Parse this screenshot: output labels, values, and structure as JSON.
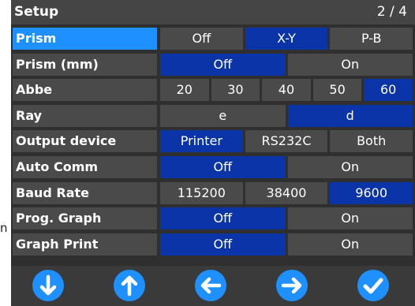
{
  "stub": {
    "text": "n"
  },
  "header": {
    "title": "Setup",
    "page": "2 / 4"
  },
  "rows": [
    {
      "label": "Prism",
      "active": true,
      "options": [
        {
          "text": "Off",
          "selected": false
        },
        {
          "text": "X-Y",
          "selected": true
        },
        {
          "text": "P-B",
          "selected": false
        }
      ]
    },
    {
      "label": "Prism (mm)",
      "active": false,
      "options": [
        {
          "text": "Off",
          "selected": true
        },
        {
          "text": "On",
          "selected": false
        }
      ]
    },
    {
      "label": "Abbe",
      "active": false,
      "options": [
        {
          "text": "20",
          "selected": false
        },
        {
          "text": "30",
          "selected": false
        },
        {
          "text": "40",
          "selected": false
        },
        {
          "text": "50",
          "selected": false
        },
        {
          "text": "60",
          "selected": true
        }
      ]
    },
    {
      "label": "Ray",
      "active": false,
      "options": [
        {
          "text": "e",
          "selected": false
        },
        {
          "text": "d",
          "selected": true
        }
      ]
    },
    {
      "label": "Output device",
      "active": false,
      "options": [
        {
          "text": "Printer",
          "selected": true
        },
        {
          "text": "RS232C",
          "selected": false
        },
        {
          "text": "Both",
          "selected": false
        }
      ]
    },
    {
      "label": "Auto Comm",
      "active": false,
      "options": [
        {
          "text": "Off",
          "selected": true
        },
        {
          "text": "On",
          "selected": false
        }
      ]
    },
    {
      "label": "Baud Rate",
      "active": false,
      "options": [
        {
          "text": "115200",
          "selected": false
        },
        {
          "text": "38400",
          "selected": false
        },
        {
          "text": "9600",
          "selected": true
        }
      ]
    },
    {
      "label": "Prog. Graph",
      "active": false,
      "options": [
        {
          "text": "Off",
          "selected": true
        },
        {
          "text": "On",
          "selected": false
        }
      ]
    },
    {
      "label": "Graph Print",
      "active": false,
      "options": [
        {
          "text": "Off",
          "selected": true
        },
        {
          "text": "On",
          "selected": false
        }
      ]
    }
  ],
  "footer": {
    "buttons": [
      {
        "name": "down-button",
        "icon": "arrow-down-icon"
      },
      {
        "name": "up-button",
        "icon": "arrow-up-icon"
      },
      {
        "name": "left-button",
        "icon": "arrow-left-icon"
      },
      {
        "name": "right-button",
        "icon": "arrow-right-icon"
      },
      {
        "name": "confirm-button",
        "icon": "check-icon"
      }
    ]
  },
  "colors": {
    "accent": "#1e90ff",
    "selected": "#0a34a8",
    "cell": "#4a4a4a",
    "background": "#2f2f2f"
  }
}
